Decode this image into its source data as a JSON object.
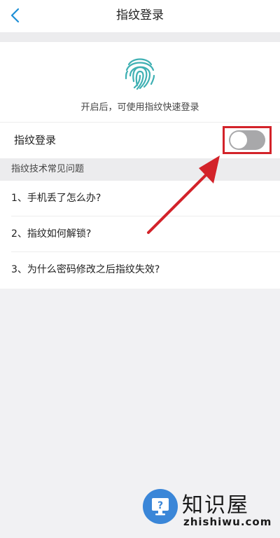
{
  "navbar": {
    "title": "指纹登录",
    "back_icon": "chevron-left-icon"
  },
  "fingerprint_card": {
    "icon": "fingerprint-icon",
    "hint": "开启后，可使用指纹快速登录"
  },
  "toggle_row": {
    "label": "指纹登录",
    "enabled": false
  },
  "faq": {
    "header": "指纹技术常见问题",
    "items": [
      {
        "label": "1、手机丢了怎么办?"
      },
      {
        "label": "2、指纹如何解锁?"
      },
      {
        "label": "3、为什么密码修改之后指纹失效?"
      }
    ]
  },
  "watermark": {
    "title": "知识屋",
    "url": "zhishiwu.com",
    "icon": "question-monitor-icon"
  },
  "colors": {
    "accent": "#3a86d8",
    "annotation": "#d3232a",
    "toggle_off": "#a8a8aa",
    "background": "#f1f1f3"
  }
}
